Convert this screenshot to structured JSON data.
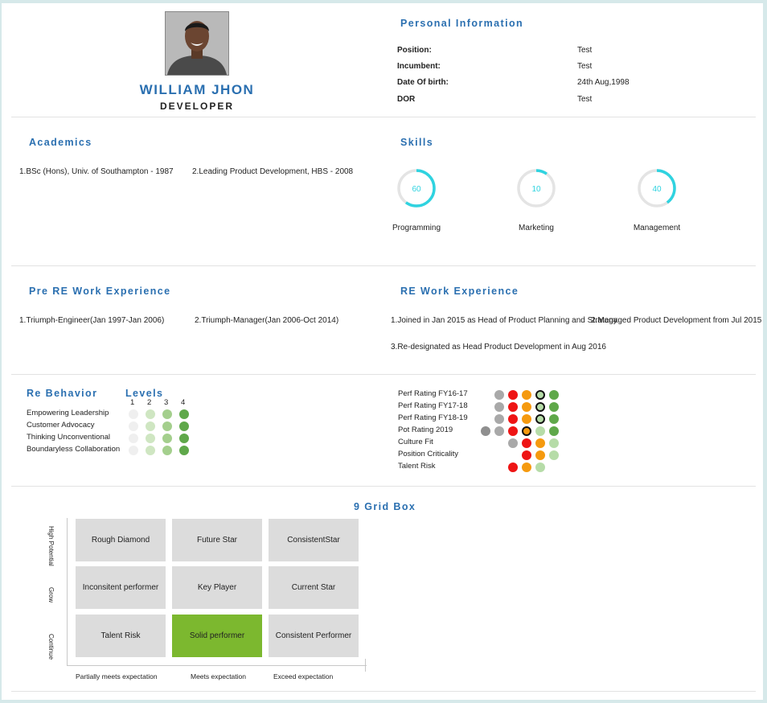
{
  "profile": {
    "name": "WILLIAM JHON",
    "role": "DEVELOPER"
  },
  "personal": {
    "title": "Personal Information",
    "rows": [
      {
        "label": "Position:",
        "value": "Test"
      },
      {
        "label": "Incumbent:",
        "value": "Test"
      },
      {
        "label": "Date Of birth:",
        "value": "24th Aug,1998"
      },
      {
        "label": "DOR",
        "value": "Test"
      }
    ]
  },
  "academics": {
    "title": "Academics",
    "items": [
      "1.BSc (Hons), Univ. of Southampton - 1987",
      "2.Leading Product Development, HBS - 2008"
    ]
  },
  "skills": {
    "title": "Skills",
    "accent": "#2fd3e0",
    "track": "#e4e4e4",
    "items": [
      {
        "label": "Programming",
        "value": "60",
        "fraction": 0.6
      },
      {
        "label": "Marketing",
        "value": "10",
        "fraction": 0.1
      },
      {
        "label": "Management",
        "value": "40",
        "fraction": 0.4
      }
    ]
  },
  "pre_re_work": {
    "title": "Pre RE Work Experience",
    "items": [
      "1.Triumph-Engineer(Jan 1997-Jan 2006)",
      "2.Triumph-Manager(Jan 2006-Oct 2014)"
    ]
  },
  "re_work": {
    "title": "RE Work Experience",
    "items": [
      "1.Joined in Jan 2015 as Head of Product Planning and Strategy",
      "2.Managed Product Development from Jul 2015",
      "3.Re-designated as Head Product Development in Aug 2016"
    ]
  },
  "behavior": {
    "title": "Re Behavior",
    "levels_title": "Levels",
    "level_numbers": [
      "1",
      "2",
      "3",
      "4"
    ],
    "level_colors": [
      "#efefef",
      "#cfe6c2",
      "#a4cf8d",
      "#5fa84a"
    ],
    "rows": [
      {
        "label": "Empowering Leadership",
        "level": 4
      },
      {
        "label": "Customer Advocacy",
        "level": 4
      },
      {
        "label": "Thinking Unconventional",
        "level": 4
      },
      {
        "label": "Boundaryless Collaboration",
        "level": 4
      }
    ]
  },
  "ratings": {
    "colors": {
      "grey": "#a9a9a9",
      "darkgrey": "#8f8f8f",
      "red": "#ee1414",
      "orange": "#f59a0f",
      "lightgreen": "#b6dca8",
      "green": "#5fa84a"
    },
    "rows": [
      {
        "label": "Perf Rating FY16-17",
        "dots": [
          "grey",
          "red",
          "orange",
          "lightgreen",
          "green"
        ],
        "selected": 3
      },
      {
        "label": "Perf Rating FY17-18",
        "dots": [
          "grey",
          "red",
          "orange",
          "lightgreen",
          "green"
        ],
        "selected": 3
      },
      {
        "label": "Perf Rating FY18-19",
        "dots": [
          "grey",
          "red",
          "orange",
          "lightgreen",
          "green"
        ],
        "selected": 3
      },
      {
        "label": "Pot Rating 2019",
        "dots": [
          "darkgrey",
          "grey",
          "red",
          "orange",
          "lightgreen",
          "green"
        ],
        "selected": 3
      },
      {
        "label": "Culture Fit",
        "dots": [
          "grey",
          "red",
          "orange",
          "lightgreen"
        ],
        "selected": -1
      },
      {
        "label": "Position Criticality",
        "dots": [
          "red",
          "orange",
          "lightgreen"
        ],
        "selected": -1
      },
      {
        "label": "Talent Risk",
        "dots": [
          "red",
          "orange",
          "lightgreen"
        ],
        "selected": -1
      }
    ]
  },
  "grid": {
    "title": "9 Grid Box",
    "highlight_color": "#7cb82f",
    "rows": [
      [
        "Rough Diamond",
        "Future Star",
        "ConsistentStar"
      ],
      [
        "Inconsitent performer",
        "Key Player",
        "Current Star"
      ],
      [
        "Talent Risk",
        "Solid performer",
        "Consistent Performer"
      ]
    ],
    "highlighted": "Solid performer",
    "y_labels": [
      "High Potential",
      "Grow",
      "Continue"
    ],
    "x_labels": [
      "Partially meets expectation",
      "Meets expectation",
      "Exceed expectation"
    ]
  }
}
